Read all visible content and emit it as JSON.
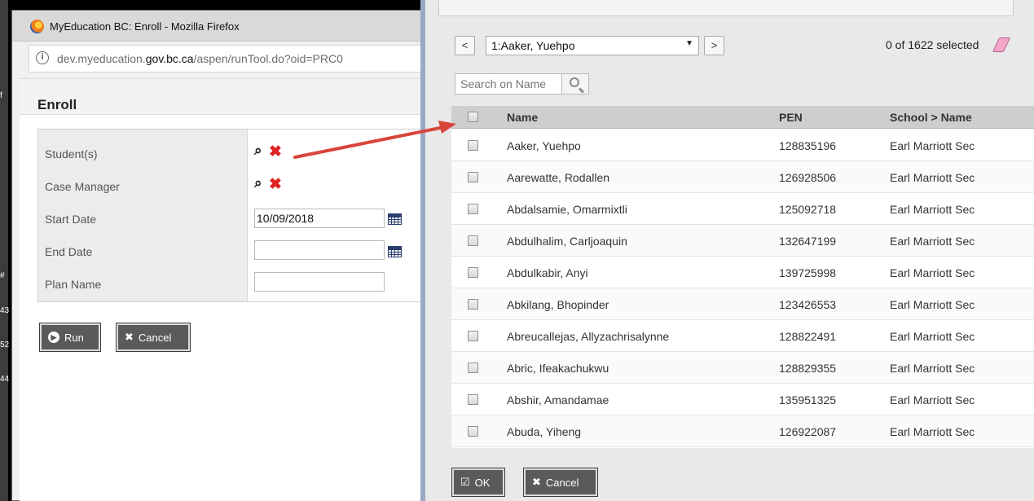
{
  "firefox": {
    "window_title": "MyEducation BC: Enroll - Mozilla Firefox",
    "url_prefix": "dev.myeducation.",
    "url_domain": "gov.bc.ca",
    "url_suffix": "/aspen/runTool.do?oid=PRC0"
  },
  "enroll": {
    "title": "Enroll",
    "fields": {
      "students_label": "Student(s)",
      "case_manager_label": "Case Manager",
      "start_date_label": "Start Date",
      "start_date_value": "10/09/2018",
      "end_date_label": "End Date",
      "end_date_value": "",
      "plan_name_label": "Plan Name",
      "plan_name_value": ""
    },
    "buttons": {
      "run": "Run",
      "cancel": "Cancel"
    }
  },
  "background_fragments": [
    "f",
    "#",
    "43",
    "52",
    "44"
  ],
  "picker": {
    "prev_label": "<",
    "next_label": ">",
    "current_selection": "1:Aaker, Yuehpo",
    "selected_count": "0 of 1622 selected",
    "search_placeholder": "Search on Name",
    "columns": [
      "Name",
      "PEN",
      "School > Name"
    ],
    "rows": [
      {
        "name": "Aaker, Yuehpo",
        "pen": "128835196",
        "school": "Earl Marriott Sec"
      },
      {
        "name": "Aarewatte, Rodallen",
        "pen": "126928506",
        "school": "Earl Marriott Sec"
      },
      {
        "name": "Abdalsamie, Omarmixtli",
        "pen": "125092718",
        "school": "Earl Marriott Sec"
      },
      {
        "name": "Abdulhalim, Carljoaquin",
        "pen": "132647199",
        "school": "Earl Marriott Sec"
      },
      {
        "name": "Abdulkabir, Anyi",
        "pen": "139725998",
        "school": "Earl Marriott Sec"
      },
      {
        "name": "Abkilang, Bhopinder",
        "pen": "123426553",
        "school": "Earl Marriott Sec"
      },
      {
        "name": "Abreucallejas, Allyzachrisalynne",
        "pen": "128822491",
        "school": "Earl Marriott Sec"
      },
      {
        "name": "Abric, Ifeakachukwu",
        "pen": "128829355",
        "school": "Earl Marriott Sec"
      },
      {
        "name": "Abshir, Amandamae",
        "pen": "135951325",
        "school": "Earl Marriott Sec"
      },
      {
        "name": "Abuda, Yiheng",
        "pen": "126922087",
        "school": "Earl Marriott Sec"
      }
    ],
    "buttons": {
      "ok": "OK",
      "cancel": "Cancel"
    }
  },
  "colors": {
    "annotation_arrow": "#d9453b",
    "delete_x": "#e02121",
    "button_bg": "#5a5a5a"
  }
}
